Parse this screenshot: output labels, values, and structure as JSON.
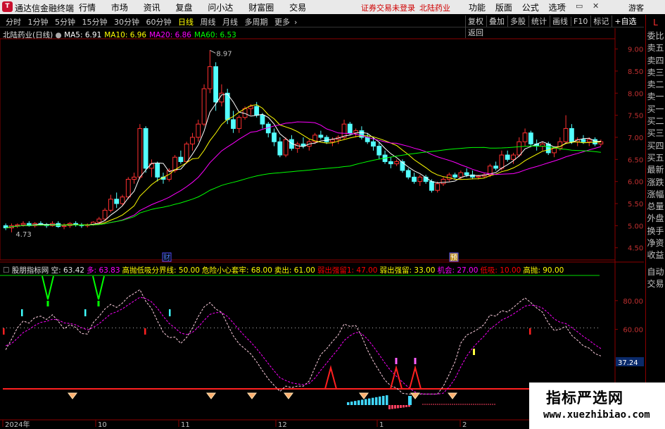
{
  "app": {
    "title": "通达信金融终端",
    "menus": [
      "行情",
      "市场",
      "资讯",
      "复盘",
      "问小达",
      "财富圈",
      "交易"
    ],
    "notice": [
      "证券交易未登录",
      "北陆药业"
    ],
    "right_menus": [
      "功能",
      "版面",
      "公式",
      "选项"
    ],
    "guest": "游客",
    "window_controls": [
      "minimize-icon",
      "restore-icon",
      "close-icon"
    ]
  },
  "toolbar": {
    "periods": [
      "分时",
      "1分钟",
      "5分钟",
      "15分钟",
      "30分钟",
      "60分钟",
      "日线",
      "周线",
      "月线",
      "多周期",
      "更多"
    ],
    "active_period": "日线",
    "tools": [
      "复权",
      "叠加",
      "多股",
      "统计",
      "画线",
      "F10",
      "标记",
      "+自选",
      "返回"
    ]
  },
  "side_panel": {
    "mark": "L",
    "items": [
      "委比",
      "卖五",
      "卖四",
      "卖三",
      "卖二",
      "卖一",
      "买一",
      "买二",
      "买三",
      "买四",
      "买五",
      "最新",
      "涨跌",
      "涨幅",
      "总量",
      "外盘",
      "换手",
      "净资",
      "收益",
      "自动",
      "交易"
    ]
  },
  "price_panel": {
    "title": "北陆药业(日线)",
    "ma": [
      {
        "label": "MA5:",
        "value": "6.91",
        "color": "#ffffff"
      },
      {
        "label": "MA10:",
        "value": "6.96",
        "color": "#ffff00"
      },
      {
        "label": "MA20:",
        "value": "6.86",
        "color": "#ff00ff"
      },
      {
        "label": "MA60:",
        "value": "6.53",
        "color": "#00ff00"
      }
    ],
    "high_label": "8.97",
    "low_label": "4.73",
    "event_labels": [
      "财",
      "预"
    ]
  },
  "indicator_panel": {
    "name": "股朋指标网",
    "values": [
      {
        "label": "空:",
        "value": "63.42",
        "color": "#e0e0e0"
      },
      {
        "label": "多:",
        "value": "63.83",
        "color": "#ff00ff"
      },
      {
        "label": "高抛低吸分界线:",
        "value": "50.00",
        "color": "#ffff00"
      },
      {
        "label": "危险小心套牢:",
        "value": "68.00",
        "color": "#ffff00"
      },
      {
        "label": "卖出:",
        "value": "61.00",
        "color": "#ffff00"
      },
      {
        "label": "弱出强留1:",
        "value": "47.00",
        "color": "#ff0000"
      },
      {
        "label": "弱出强留:",
        "value": "33.00",
        "color": "#ffff00"
      },
      {
        "label": "机会:",
        "value": "27.00",
        "color": "#ff00ff"
      },
      {
        "label": "低吸:",
        "value": "10.00",
        "color": "#ff0000"
      },
      {
        "label": "高抛:",
        "value": "90.00",
        "color": "#ffff00"
      }
    ],
    "current_tag": "37.24"
  },
  "price_axis": [
    "9.00",
    "8.50",
    "8.00",
    "7.50",
    "7.00",
    "6.50",
    "6.00",
    "5.50",
    "5.00",
    "4.50"
  ],
  "indicator_axis": [
    "80.00",
    "60.00",
    "20.00"
  ],
  "date_axis": [
    "2024年",
    "10",
    "11",
    "12",
    "1",
    "2"
  ],
  "watermark": {
    "line1": "指标严选网",
    "line2": "www.xuezhibiao.com"
  },
  "chart_data": {
    "type": "candlestick",
    "ylim": [
      4.4,
      9.2
    ],
    "ohlc": [
      [
        5.0,
        5.05,
        4.9,
        4.95
      ],
      [
        4.95,
        5.05,
        4.85,
        5.0
      ],
      [
        5.0,
        5.05,
        4.95,
        5.02
      ],
      [
        5.02,
        5.1,
        4.98,
        5.05
      ],
      [
        5.05,
        5.1,
        4.98,
        5.0
      ],
      [
        5.0,
        5.08,
        4.96,
        5.05
      ],
      [
        5.05,
        5.1,
        5.0,
        5.03
      ],
      [
        5.03,
        5.06,
        4.95,
        5.0
      ],
      [
        5.0,
        5.1,
        4.98,
        5.05
      ],
      [
        5.05,
        5.1,
        4.95,
        4.98
      ],
      [
        4.98,
        5.05,
        4.92,
        5.0
      ],
      [
        5.0,
        5.08,
        4.95,
        5.05
      ],
      [
        5.05,
        5.1,
        4.98,
        5.02
      ],
      [
        5.02,
        5.06,
        4.95,
        5.0
      ],
      [
        5.0,
        5.05,
        4.96,
        5.02
      ],
      [
        5.02,
        5.1,
        5.0,
        5.08
      ],
      [
        5.08,
        5.2,
        5.05,
        5.15
      ],
      [
        5.15,
        5.4,
        5.1,
        5.35
      ],
      [
        5.35,
        5.7,
        5.3,
        5.6
      ],
      [
        5.6,
        5.75,
        5.4,
        5.5
      ],
      [
        5.5,
        5.7,
        5.45,
        5.65
      ],
      [
        5.65,
        6.1,
        5.6,
        6.05
      ],
      [
        6.05,
        6.2,
        5.95,
        6.1
      ],
      [
        6.1,
        7.3,
        6.05,
        7.2
      ],
      [
        7.2,
        7.25,
        6.2,
        6.3
      ],
      [
        6.3,
        6.5,
        6.1,
        6.4
      ],
      [
        6.4,
        6.45,
        6.0,
        6.1
      ],
      [
        6.1,
        6.2,
        5.95,
        6.05
      ],
      [
        6.05,
        6.3,
        6.0,
        6.25
      ],
      [
        6.25,
        6.6,
        6.2,
        6.55
      ],
      [
        6.55,
        6.7,
        6.4,
        6.45
      ],
      [
        6.45,
        6.9,
        6.4,
        6.85
      ],
      [
        6.85,
        7.1,
        6.7,
        7.0
      ],
      [
        7.0,
        7.4,
        6.9,
        7.3
      ],
      [
        7.3,
        8.2,
        7.25,
        8.1
      ],
      [
        8.1,
        8.97,
        8.0,
        8.6
      ],
      [
        8.6,
        8.7,
        7.6,
        7.8
      ],
      [
        7.8,
        8.2,
        7.7,
        8.0
      ],
      [
        8.0,
        8.1,
        7.3,
        7.4
      ],
      [
        7.4,
        7.6,
        7.1,
        7.2
      ],
      [
        7.2,
        7.5,
        7.1,
        7.45
      ],
      [
        7.45,
        7.7,
        7.4,
        7.65
      ],
      [
        7.65,
        7.75,
        7.5,
        7.7
      ],
      [
        7.7,
        7.8,
        7.45,
        7.5
      ],
      [
        7.5,
        7.55,
        7.2,
        7.3
      ],
      [
        7.3,
        7.35,
        7.0,
        7.1
      ],
      [
        7.1,
        7.2,
        6.8,
        6.9
      ],
      [
        6.9,
        7.0,
        6.55,
        6.6
      ],
      [
        6.6,
        7.0,
        6.55,
        6.95
      ],
      [
        6.95,
        7.05,
        6.7,
        6.75
      ],
      [
        6.75,
        6.9,
        6.65,
        6.85
      ],
      [
        6.85,
        7.0,
        6.75,
        6.8
      ],
      [
        6.8,
        6.95,
        6.7,
        6.9
      ],
      [
        6.9,
        7.1,
        6.85,
        7.05
      ],
      [
        7.05,
        7.15,
        6.95,
        7.0
      ],
      [
        7.0,
        7.05,
        6.85,
        6.9
      ],
      [
        6.9,
        7.0,
        6.8,
        6.95
      ],
      [
        6.95,
        7.05,
        6.85,
        7.0
      ],
      [
        7.0,
        7.4,
        6.95,
        7.3
      ],
      [
        7.3,
        7.35,
        7.05,
        7.1
      ],
      [
        7.1,
        7.2,
        7.0,
        7.15
      ],
      [
        7.15,
        7.25,
        6.95,
        7.0
      ],
      [
        7.0,
        7.1,
        6.85,
        6.9
      ],
      [
        6.9,
        7.0,
        6.7,
        6.8
      ],
      [
        6.8,
        6.9,
        6.5,
        6.6
      ],
      [
        6.6,
        6.7,
        6.4,
        6.45
      ],
      [
        6.45,
        6.55,
        6.3,
        6.4
      ],
      [
        6.4,
        6.5,
        6.35,
        6.45
      ],
      [
        6.45,
        6.5,
        6.2,
        6.25
      ],
      [
        6.25,
        6.3,
        6.05,
        6.1
      ],
      [
        6.1,
        6.2,
        5.95,
        6.0
      ],
      [
        6.0,
        6.15,
        5.9,
        6.1
      ],
      [
        6.1,
        6.15,
        5.95,
        6.0
      ],
      [
        6.0,
        6.05,
        5.75,
        5.8
      ],
      [
        5.8,
        6.0,
        5.75,
        5.95
      ],
      [
        5.95,
        6.1,
        5.9,
        6.05
      ],
      [
        6.05,
        6.2,
        6.0,
        6.15
      ],
      [
        6.15,
        6.2,
        6.05,
        6.1
      ],
      [
        6.1,
        6.25,
        6.05,
        6.2
      ],
      [
        6.2,
        6.3,
        6.1,
        6.15
      ],
      [
        6.15,
        6.25,
        6.05,
        6.1
      ],
      [
        6.1,
        6.15,
        6.05,
        6.12
      ],
      [
        6.12,
        6.2,
        6.08,
        6.15
      ],
      [
        6.15,
        6.4,
        6.1,
        6.35
      ],
      [
        6.35,
        6.45,
        6.25,
        6.3
      ],
      [
        6.3,
        6.7,
        6.25,
        6.6
      ],
      [
        6.6,
        6.7,
        6.45,
        6.5
      ],
      [
        6.5,
        6.65,
        6.4,
        6.6
      ],
      [
        6.6,
        7.0,
        6.55,
        6.9
      ],
      [
        6.9,
        7.2,
        6.8,
        7.1
      ],
      [
        7.1,
        7.15,
        6.8,
        6.85
      ],
      [
        6.85,
        6.95,
        6.7,
        6.8
      ],
      [
        6.8,
        6.9,
        6.7,
        6.85
      ],
      [
        6.85,
        6.9,
        6.6,
        6.65
      ],
      [
        6.65,
        6.8,
        6.55,
        6.75
      ],
      [
        6.75,
        7.0,
        6.7,
        6.9
      ],
      [
        6.9,
        7.5,
        6.85,
        7.2
      ],
      [
        7.2,
        7.3,
        6.85,
        6.9
      ],
      [
        6.9,
        7.0,
        6.8,
        6.95
      ],
      [
        6.95,
        7.05,
        6.85,
        6.9
      ],
      [
        6.9,
        7.0,
        6.8,
        6.95
      ],
      [
        6.95,
        7.0,
        6.8,
        6.85
      ],
      [
        6.85,
        6.95,
        6.8,
        6.9
      ]
    ]
  }
}
